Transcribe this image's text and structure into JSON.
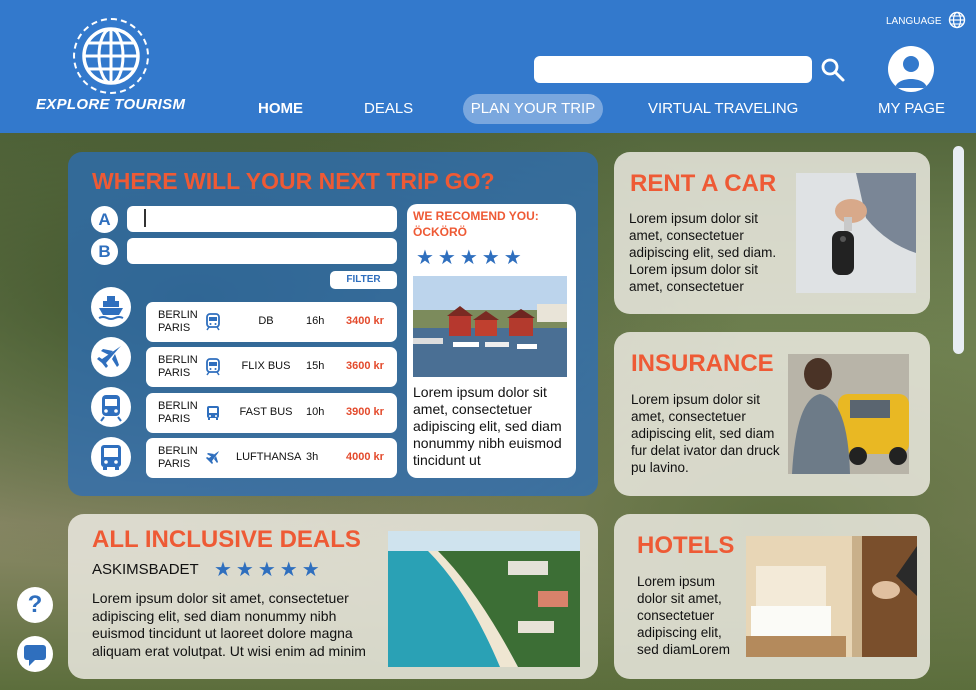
{
  "header": {
    "brand": "EXPLORE TOURISM",
    "language_label": "LANGUAGE",
    "search_placeholder": "",
    "nav": {
      "home": "HOME",
      "deals": "DEALS",
      "plan": "PLAN YOUR TRIP",
      "virtual": "VIRTUAL TRAVELING",
      "mypage": "MY PAGE"
    }
  },
  "trip": {
    "title": "WHERE WILL YOUR NEXT TRIP GO?",
    "from_label": "A",
    "to_label": "B",
    "from_value": "",
    "to_value": "",
    "filter_label": "FILTER",
    "routes": [
      {
        "from": "BERLIN",
        "to": "PARIS",
        "carrier": "DB",
        "duration": "16h",
        "price": "3400 kr",
        "icon": "train-icon"
      },
      {
        "from": "BERLIN",
        "to": "PARIS",
        "carrier": "FLIX BUS",
        "duration": "15h",
        "price": "3600 kr",
        "icon": "train-icon"
      },
      {
        "from": "BERLIN",
        "to": "PARIS",
        "carrier": "FAST BUS",
        "duration": "10h",
        "price": "3900 kr",
        "icon": "bus-icon"
      },
      {
        "from": "BERLIN",
        "to": "PARIS",
        "carrier": "LUFTHANSA",
        "duration": "3h",
        "price": "4000 kr",
        "icon": "plane-icon"
      }
    ],
    "modes": [
      "ship-icon",
      "plane-icon",
      "train-icon",
      "bus-icon"
    ]
  },
  "recommend": {
    "title": "WE RECOMEND YOU: ÖCKÖRÖ",
    "stars": "★★★★★",
    "rating": 5,
    "text": "Lorem ipsum dolor sit amet, consectetuer adipiscing elit, sed diam nonummy nibh euismod tincidunt ut"
  },
  "rent": {
    "title": "RENT A CAR",
    "text": "Lorem ipsum dolor sit amet, consectetuer adipiscing elit, sed diam. Lorem ipsum dolor sit amet, consectetuer"
  },
  "insurance": {
    "title": "INSURANCE",
    "text": "Lorem ipsum dolor sit amet, consectetuer adipiscing elit, sed diam fur delat ivator dan druck pu lavino."
  },
  "deals": {
    "title": "ALL INCLUSIVE DEALS",
    "place": "ASKIMSBADET",
    "stars": "★★★★★",
    "rating": 5,
    "text": "Lorem ipsum dolor sit amet, consectetuer adipiscing elit, sed diam nonummy nibh euismod tincidunt ut laoreet dolore magna aliquam erat volutpat. Ut wisi enim ad minim"
  },
  "hotels": {
    "title": "HOTELS",
    "text": "Lorem ipsum dolor sit amet, consectetuer adipiscing elit, sed diamLorem"
  },
  "help": {
    "glyph": "?"
  },
  "colors": {
    "primary": "#3379cc",
    "accent": "#ee5a35",
    "price": "#e34a2c"
  }
}
